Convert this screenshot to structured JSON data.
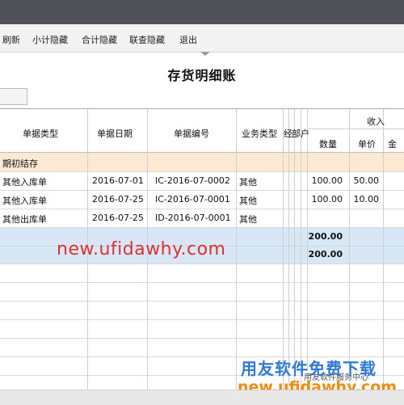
{
  "toolbar": {
    "items": [
      "刷新",
      "小计隐藏",
      "合计隐藏",
      "联查隐藏",
      "退出"
    ]
  },
  "page_title": "存货明细账",
  "table": {
    "headers": {
      "doc_type": "单据类型",
      "doc_date": "单据日期",
      "doc_no": "单据编号",
      "biz_type": "业务类型",
      "cut1": "经",
      "cut2": "部",
      "cut3": "户",
      "income": "收入",
      "qty": "数量",
      "price": "单价",
      "amt_cut": "金"
    },
    "opening_row": "期初结存",
    "rows": [
      {
        "type": "其他入库单",
        "date": "2016-07-01",
        "no": "IC-2016-07-0002",
        "biz": "其他",
        "qty": "100.00",
        "price": "50.00"
      },
      {
        "type": "其他入库单",
        "date": "2016-07-25",
        "no": "IC-2016-07-0001",
        "biz": "其他",
        "qty": "100.00",
        "price": "10.00"
      },
      {
        "type": "其他出库单",
        "date": "2016-07-25",
        "no": "ID-2016-07-0001",
        "biz": "其他",
        "qty": "",
        "price": ""
      }
    ],
    "subtotal_qty": "200.00",
    "total_qty": "200.00"
  },
  "watermark": "new.ufidawhy.com",
  "brand": {
    "line1": "用友软件免费下载",
    "line2": "new.ufidawhy.com",
    "credit": "用友软件服务中心"
  },
  "colors": {
    "opening_band": "#fbe9d2",
    "summary_band": "#d8e7f5",
    "watermark": "#e03030",
    "brand_blue": "#2e7ad6",
    "brand_orange": "#f08a10"
  }
}
